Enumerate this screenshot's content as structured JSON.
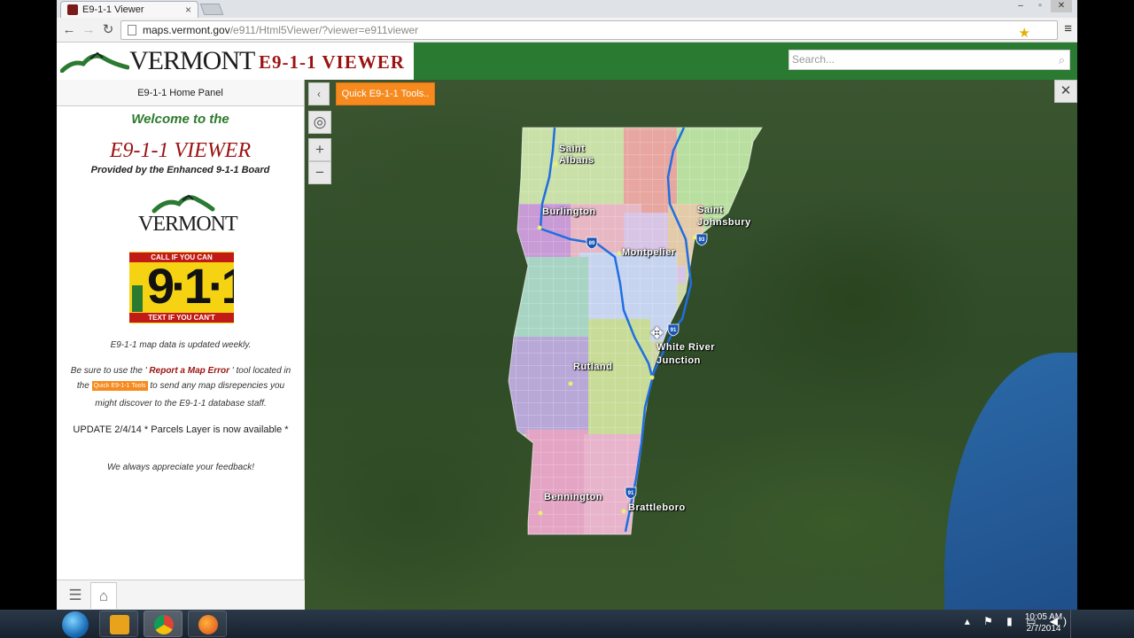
{
  "browser": {
    "tab_title": "E9-1-1 Viewer",
    "tab_close": "×",
    "url_host": "maps.vermont.gov",
    "url_path": "/e911/Html5Viewer/?viewer=e911viewer",
    "win_min": "–",
    "win_max": "▫",
    "win_close": "✕",
    "back": "←",
    "forward": "→",
    "reload": "↻",
    "star": "★",
    "menu": "≡"
  },
  "header": {
    "brand_name": "VERMONT",
    "app_title": "E9-1-1  VIEWER",
    "search_placeholder": "Search...",
    "search_icon": "⌕"
  },
  "panel": {
    "header": "E9-1-1 Home Panel",
    "welcome": "Welcome to the",
    "title": "E9-1-1 VIEWER",
    "provided_by": "Provided by the Enhanced 9-1-1 Board",
    "vt_logo": "VERMONT",
    "sign_top": "CALL IF YOU CAN",
    "sign_number": "9·1·1",
    "sign_bottom": "TEXT IF YOU CAN'T",
    "updated": "E9-1-1 map data is updated weekly.",
    "tip_pre": "Be sure to use the '",
    "tip_tool": " Report a Map Error ",
    "tip_mid": "' tool located in",
    "tip_the": "the ",
    "tip_btn": "Quick E9-1-1 Tools",
    "tip_post": " to send any map disrepencies you",
    "tip_line3": "might discover to the E9-1-1 database staff.",
    "update_note": "UPDATE 2/4/14 * Parcels Layer is now available *",
    "feedback": "We always appreciate your feedback!",
    "foot_layers_icon": "layers-icon",
    "foot_home_icon": "home-icon"
  },
  "map": {
    "collapse": "‹",
    "quick_tools": "Quick E9-1-1 Tools..",
    "locate": "◎",
    "zoom_in": "+",
    "zoom_out": "−",
    "tools_icon": "✕",
    "cities": [
      "Saint\nAlbans",
      "Burlington",
      "Montpelier",
      "Saint\nJohnsbury",
      "Rutland",
      "White River\nJunction",
      "Bennington",
      "Brattleboro"
    ],
    "city_1": "Saint",
    "city_1b": "Albans",
    "city_2": "Burlington",
    "city_3": "Montpelier",
    "city_4": "Saint",
    "city_4b": "Johnsbury",
    "city_5": "Rutland",
    "city_6": "White River",
    "city_6b": "Junction",
    "city_7": "Bennington",
    "city_8": "Brattleboro",
    "shield_89": "89",
    "shield_91a": "91",
    "shield_91b": "91",
    "shield_93": "93"
  },
  "taskbar": {
    "time": "10:05 AM",
    "date": "2/7/2014",
    "tray": "▴ ⚑ ▮ ▭ ◀)"
  }
}
